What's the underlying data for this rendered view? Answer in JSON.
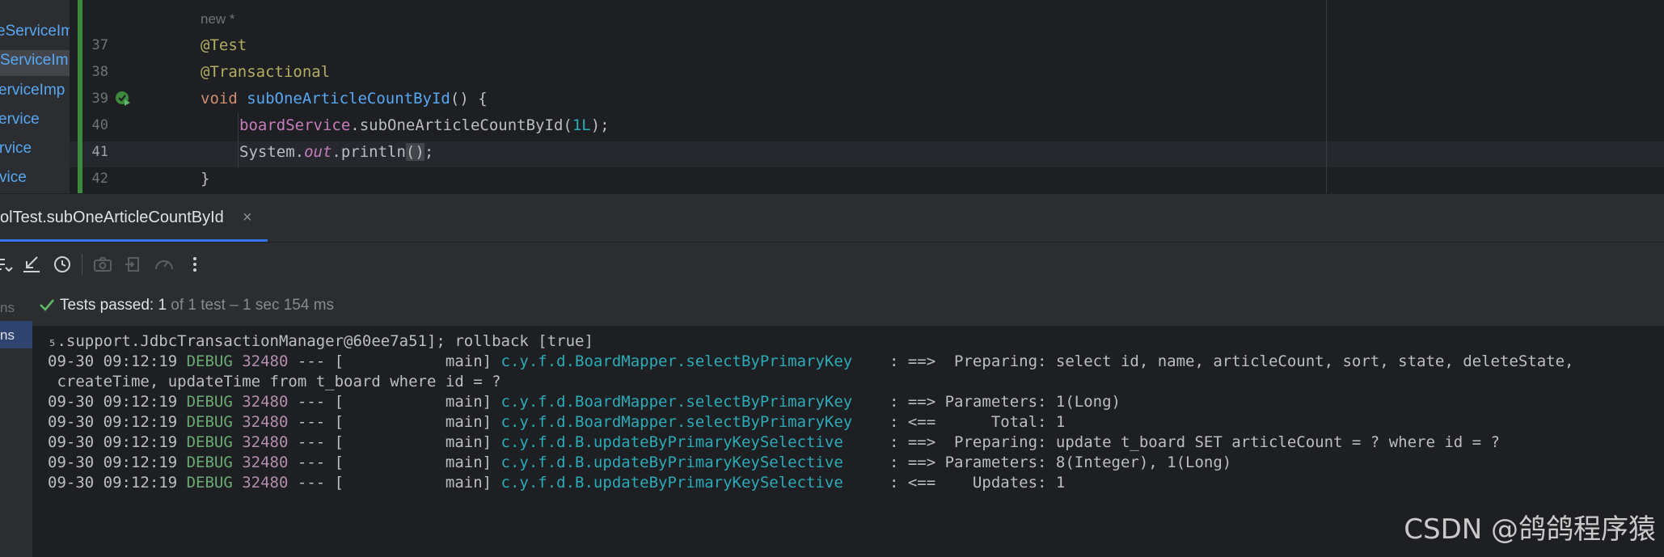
{
  "project_panel": {
    "items": [
      "eServiceIm",
      "ServiceIm",
      "erviceImp",
      "ervice",
      "rvice",
      "vice"
    ]
  },
  "editor": {
    "hint_text": "new *",
    "line_numbers": [
      "37",
      "38",
      "39",
      "40",
      "41",
      "42"
    ],
    "lines": {
      "l37_annotation": "@Test",
      "l38_annotation": "@Transactional",
      "l39_keyword": "void ",
      "l39_method": "subOneArticleCountById",
      "l39_rest": "() {",
      "l40_field": "boardService",
      "l40_call": ".subOneArticleCountById(",
      "l40_number": "1L",
      "l40_end": ");",
      "l41_prefix": "System.",
      "l41_static": "out",
      "l41_call": ".println",
      "l41_parens": "()",
      "l41_end": ";",
      "l42_brace": "}"
    }
  },
  "run_tab": {
    "label": "olTest.subOneArticleCountById",
    "close": "×"
  },
  "toolbar": {
    "icons": [
      "tree-expand-icon",
      "collapse-icon",
      "history-icon",
      "camera-icon",
      "export-icon",
      "speedometer-icon",
      "more-vert-icon"
    ]
  },
  "tree": {
    "items": [
      "ns",
      "ns"
    ]
  },
  "status": {
    "passed_label": "Tests passed: 1",
    "detail": " of 1 test – 1 sec 154 ms",
    "color_pass": "#5fb865"
  },
  "console": {
    "first_line": "₅.support.JdbcTransactionManager@60ee7a51]; rollback [true]",
    "rows": [
      {
        "ts": "09-30 09:12:19 ",
        "level": "DEBUG",
        "pid": " 32480",
        "thread": " --- [           main] ",
        "logger": "c.y.f.d.BoardMapper.selectByPrimaryKey   ",
        "msg": " : ==>  Preparing: select id, name, articleCount, sort, state, deleteState,"
      },
      {
        "continuation": " createTime, updateTime from t_board where id = ?"
      },
      {
        "ts": "09-30 09:12:19 ",
        "level": "DEBUG",
        "pid": " 32480",
        "thread": " --- [           main] ",
        "logger": "c.y.f.d.BoardMapper.selectByPrimaryKey   ",
        "msg": " : ==> Parameters: 1(Long)"
      },
      {
        "ts": "09-30 09:12:19 ",
        "level": "DEBUG",
        "pid": " 32480",
        "thread": " --- [           main] ",
        "logger": "c.y.f.d.BoardMapper.selectByPrimaryKey   ",
        "msg": " : <==      Total: 1"
      },
      {
        "ts": "09-30 09:12:19 ",
        "level": "DEBUG",
        "pid": " 32480",
        "thread": " --- [           main] ",
        "logger": "c.y.f.d.B.updateByPrimaryKeySelective    ",
        "msg": " : ==>  Preparing: update t_board SET articleCount = ? where id = ?"
      },
      {
        "ts": "09-30 09:12:19 ",
        "level": "DEBUG",
        "pid": " 32480",
        "thread": " --- [           main] ",
        "logger": "c.y.f.d.B.updateByPrimaryKeySelective    ",
        "msg": " : ==> Parameters: 8(Integer), 1(Long)"
      },
      {
        "ts": "09-30 09:12:19 ",
        "level": "DEBUG",
        "pid": " 32480",
        "thread": " --- [           main] ",
        "logger": "c.y.f.d.B.updateByPrimaryKeySelective    ",
        "msg": " : <==    Updates: 1"
      }
    ]
  },
  "watermark": "CSDN @鸽鸽程序猿"
}
